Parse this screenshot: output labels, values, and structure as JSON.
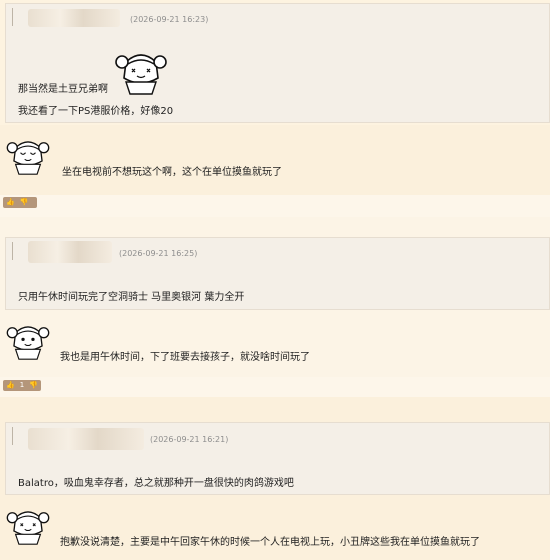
{
  "posts": [
    {
      "quote": {
        "timestamp": "(2026-09-21 16:23)",
        "lines": [
          "那当然是土豆兄弟啊",
          "我还看了一下PS港服价格，好像20"
        ]
      },
      "reply": "坐在电视前不想玩这个啊，这个在单位摸鱼就玩了",
      "vote": {
        "up": "👍",
        "down": "👎",
        "count": ""
      }
    },
    {
      "quote": {
        "timestamp": "(2026-09-21 16:25)",
        "lines": [
          "只用午休时间玩完了空洞骑士 马里奥银河 葉力全开"
        ]
      },
      "reply": "我也是用午休时间，下了班要去接孩子，就没啥时间玩了",
      "vote": {
        "up": "👍",
        "down": "👎",
        "count": "1"
      }
    },
    {
      "quote": {
        "timestamp": "(2026-09-21 16:21)",
        "lines": [
          "Balatro，吸血鬼幸存者，总之就那种开一盘很快的肉鸽游戏吧"
        ]
      },
      "reply": "抱歉没说清楚，主要是中午回家午休的时候一个人在电视上玩，小丑牌这些我在单位摸鱼就玩了"
    }
  ]
}
